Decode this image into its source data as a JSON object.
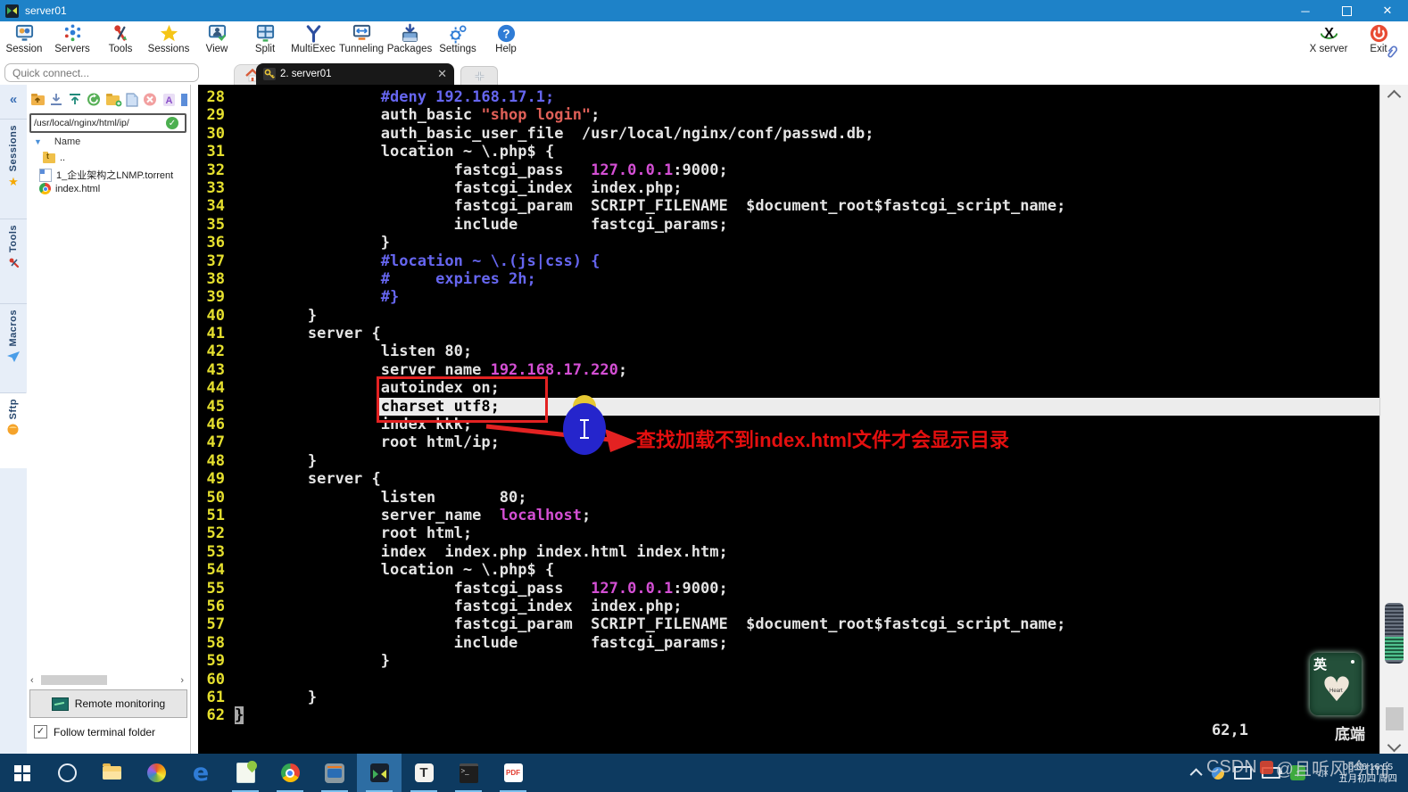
{
  "window": {
    "title": "server01"
  },
  "toolbar": {
    "items": [
      {
        "label": "Session",
        "icon": "session-monitor-icon"
      },
      {
        "label": "Servers",
        "icon": "servers-network-icon"
      },
      {
        "label": "Tools",
        "icon": "tools-icon"
      },
      {
        "label": "Sessions",
        "icon": "sessions-star-icon"
      },
      {
        "label": "View",
        "icon": "view-monitor-icon"
      },
      {
        "label": "Split",
        "icon": "split-window-icon"
      },
      {
        "label": "MultiExec",
        "icon": "multiexec-fork-icon"
      },
      {
        "label": "Tunneling",
        "icon": "tunneling-icon"
      },
      {
        "label": "Packages",
        "icon": "packages-icon"
      },
      {
        "label": "Settings",
        "icon": "settings-gear-icon"
      },
      {
        "label": "Help",
        "icon": "help-icon"
      }
    ],
    "right": [
      {
        "label": "X server",
        "icon": "x-server-icon"
      },
      {
        "label": "Exit",
        "icon": "exit-power-icon"
      }
    ]
  },
  "quick_connect": {
    "placeholder": "Quick connect..."
  },
  "tabs": {
    "home_icon": "home-icon",
    "active_label": "2. server01",
    "close_icon": "close-icon",
    "new_tab_icon": "plus-icon"
  },
  "side_strip": {
    "collapse": "«",
    "tabs": [
      "Sessions",
      "Tools",
      "Macros",
      "Sftp"
    ]
  },
  "sidebar": {
    "path": "/usr/local/nginx/html/ip/",
    "tree_header": "Name",
    "files": [
      {
        "name": "..",
        "icon": "folder-up-icon"
      },
      {
        "name": "1_企业架构之LNMP.torrent",
        "icon": "torrent-file-icon"
      },
      {
        "name": "index.html",
        "icon": "chrome-html-icon"
      }
    ],
    "remote_monitoring_label": "Remote monitoring",
    "follow_label": "Follow terminal folder",
    "follow_checked": "✓"
  },
  "terminal": {
    "colors": {
      "background": "#000000",
      "text": "#e4e4e4",
      "line_number": "#e5df2e",
      "comment": "#6666f0",
      "string": "#df6058",
      "constant": "#d44fd4",
      "cursorline": "#ececec",
      "annotation_red": "#e40f0f"
    },
    "lines": [
      {
        "n": 28,
        "seg": [
          [
            "c",
            "                #deny 192.168.17.1;"
          ]
        ]
      },
      {
        "n": 29,
        "seg": [
          [
            "w",
            "                auth_basic "
          ],
          [
            "s",
            "\"shop login\""
          ],
          [
            "w",
            ";"
          ]
        ]
      },
      {
        "n": 30,
        "seg": [
          [
            "w",
            "                auth_basic_user_file  /usr/local/nginx/conf/passwd.db;"
          ]
        ]
      },
      {
        "n": 31,
        "seg": [
          [
            "w",
            "                location ~ \\.php$ {"
          ]
        ]
      },
      {
        "n": 32,
        "seg": [
          [
            "w",
            "                        fastcgi_pass   "
          ],
          [
            "m",
            "127.0.0.1"
          ],
          [
            "w",
            ":9000;"
          ]
        ]
      },
      {
        "n": 33,
        "seg": [
          [
            "w",
            "                        fastcgi_index  index.php;"
          ]
        ]
      },
      {
        "n": 34,
        "seg": [
          [
            "w",
            "                        fastcgi_param  SCRIPT_FILENAME  $document_root$fastcgi_script_name;"
          ]
        ]
      },
      {
        "n": 35,
        "seg": [
          [
            "w",
            "                        include        fastcgi_params;"
          ]
        ]
      },
      {
        "n": 36,
        "seg": [
          [
            "w",
            "                }"
          ]
        ]
      },
      {
        "n": 37,
        "seg": [
          [
            "c",
            "                #location ~ \\.(js|css) {"
          ]
        ]
      },
      {
        "n": 38,
        "seg": [
          [
            "c",
            "                #     expires 2h;"
          ]
        ]
      },
      {
        "n": 39,
        "seg": [
          [
            "c",
            "                #}"
          ]
        ]
      },
      {
        "n": 40,
        "seg": [
          [
            "w",
            "        }"
          ]
        ]
      },
      {
        "n": 41,
        "seg": [
          [
            "w",
            "        server {"
          ]
        ]
      },
      {
        "n": 42,
        "seg": [
          [
            "w",
            "                listen 80;"
          ]
        ]
      },
      {
        "n": 43,
        "seg": [
          [
            "w",
            "                server_name "
          ],
          [
            "m",
            "192.168.17.220"
          ],
          [
            "w",
            ";"
          ]
        ]
      },
      {
        "n": 44,
        "seg": [
          [
            "w",
            "                autoindex on;"
          ]
        ]
      },
      {
        "n": 45,
        "hl": true,
        "seg": [
          [
            "w",
            "                charset utf8;"
          ]
        ]
      },
      {
        "n": 46,
        "seg": [
          [
            "w",
            "                index kkk;"
          ]
        ]
      },
      {
        "n": 47,
        "seg": [
          [
            "w",
            "                root html/ip;"
          ]
        ]
      },
      {
        "n": 48,
        "seg": [
          [
            "w",
            "        }"
          ]
        ]
      },
      {
        "n": 49,
        "seg": [
          [
            "w",
            "        server {"
          ]
        ]
      },
      {
        "n": 50,
        "seg": [
          [
            "w",
            "                listen       80;"
          ]
        ]
      },
      {
        "n": 51,
        "seg": [
          [
            "w",
            "                server_name  "
          ],
          [
            "m",
            "localhost"
          ],
          [
            "w",
            ";"
          ]
        ]
      },
      {
        "n": 52,
        "seg": [
          [
            "w",
            "                root html;"
          ]
        ]
      },
      {
        "n": 53,
        "seg": [
          [
            "w",
            "                index  index.php index.html index.htm;"
          ]
        ]
      },
      {
        "n": 54,
        "seg": [
          [
            "w",
            "                location ~ \\.php$ {"
          ]
        ]
      },
      {
        "n": 55,
        "seg": [
          [
            "w",
            "                        fastcgi_pass   "
          ],
          [
            "m",
            "127.0.0.1"
          ],
          [
            "w",
            ":9000;"
          ]
        ]
      },
      {
        "n": 56,
        "seg": [
          [
            "w",
            "                        fastcgi_index  index.php;"
          ]
        ]
      },
      {
        "n": 57,
        "seg": [
          [
            "w",
            "                        fastcgi_param  SCRIPT_FILENAME  $document_root$fastcgi_script_name;"
          ]
        ]
      },
      {
        "n": 58,
        "seg": [
          [
            "w",
            "                        include        fastcgi_params;"
          ]
        ]
      },
      {
        "n": 59,
        "seg": [
          [
            "w",
            "                }"
          ]
        ]
      },
      {
        "n": 60,
        "seg": []
      },
      {
        "n": 61,
        "seg": [
          [
            "w",
            "        }"
          ]
        ]
      },
      {
        "n": 62,
        "seg": [
          [
            "cur",
            "}"
          ]
        ]
      }
    ],
    "annotation": "查找加载不到index.html文件才会显示目录",
    "status": {
      "position": "62,1",
      "scroll": "底端"
    }
  },
  "sticker": {
    "char": "英",
    "heart_glyph": "♥",
    "heart_label": "Heart"
  },
  "taskbar": {
    "icons": [
      "start-icon",
      "cortana-icon",
      "explorer-icon",
      "photos-pinwheel-icon",
      "edge-icon",
      "notepadpp-icon",
      "chrome-icon",
      "vmware-icon",
      "mobaxterm-icon",
      "typora-icon",
      "cmd-terminal-icon",
      "pdf-reader-icon"
    ],
    "edge_letter": "e",
    "typora_letter": "T",
    "pdf_label": "PDF",
    "tray": {
      "time": "06-06 16:55",
      "date": "五月初四 周四",
      "mute_label": "×",
      "up_arrow": "↑"
    },
    "watermark": "CSDN @且听风吟tmj",
    "watermark_prefix": "CSDN",
    "watermark_suffix": "@且听风吟tmj"
  }
}
